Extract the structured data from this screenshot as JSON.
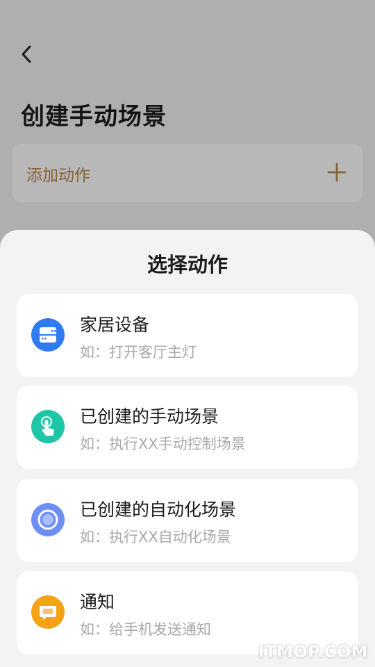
{
  "header": {
    "back_icon": "chevron-left-icon",
    "title": "创建手动场景"
  },
  "add_action": {
    "label": "添加动作",
    "icon": "plus-icon",
    "accent_color": "#b58b4a"
  },
  "sheet": {
    "title": "选择动作",
    "items": [
      {
        "title": "家居设备",
        "subtitle": "如：打开客厅主灯",
        "icon": "device-icon",
        "color": "#2f7bf3"
      },
      {
        "title": "已创建的手动场景",
        "subtitle": "如：执行XX手动控制场景",
        "icon": "hand-tap-icon",
        "color": "#1cc6a7"
      },
      {
        "title": "已创建的自动化场景",
        "subtitle": "如：执行XX自动化场景",
        "icon": "auto-circle-icon",
        "color": "#6f8ef4"
      },
      {
        "title": "通知",
        "subtitle": "如：给手机发送通知",
        "icon": "message-icon",
        "color": "#f5a215"
      }
    ]
  },
  "watermark": "ITMOP.COM"
}
